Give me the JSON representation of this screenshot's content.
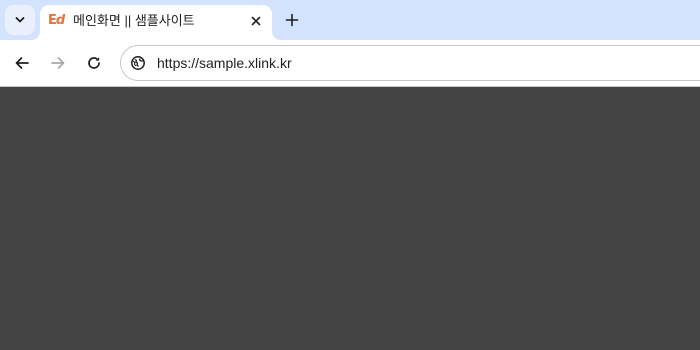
{
  "tabstrip": {
    "active_tab": {
      "favicon_letters": "Ed",
      "favicon_color": "#e8713a",
      "title": "메인화면 || 샘플사이트"
    },
    "icons": {
      "tab_search": "chevron-down-icon",
      "close": "close-icon",
      "new_tab": "plus-icon"
    }
  },
  "toolbar": {
    "url": "https://sample.xlink.kr",
    "icons": {
      "back": "arrow-left-icon",
      "forward": "arrow-right-icon",
      "reload": "reload-icon",
      "site_info": "globe-icon"
    }
  },
  "colors": {
    "tabstrip_bg": "#d3e3fd",
    "page_bg": "#444444"
  }
}
